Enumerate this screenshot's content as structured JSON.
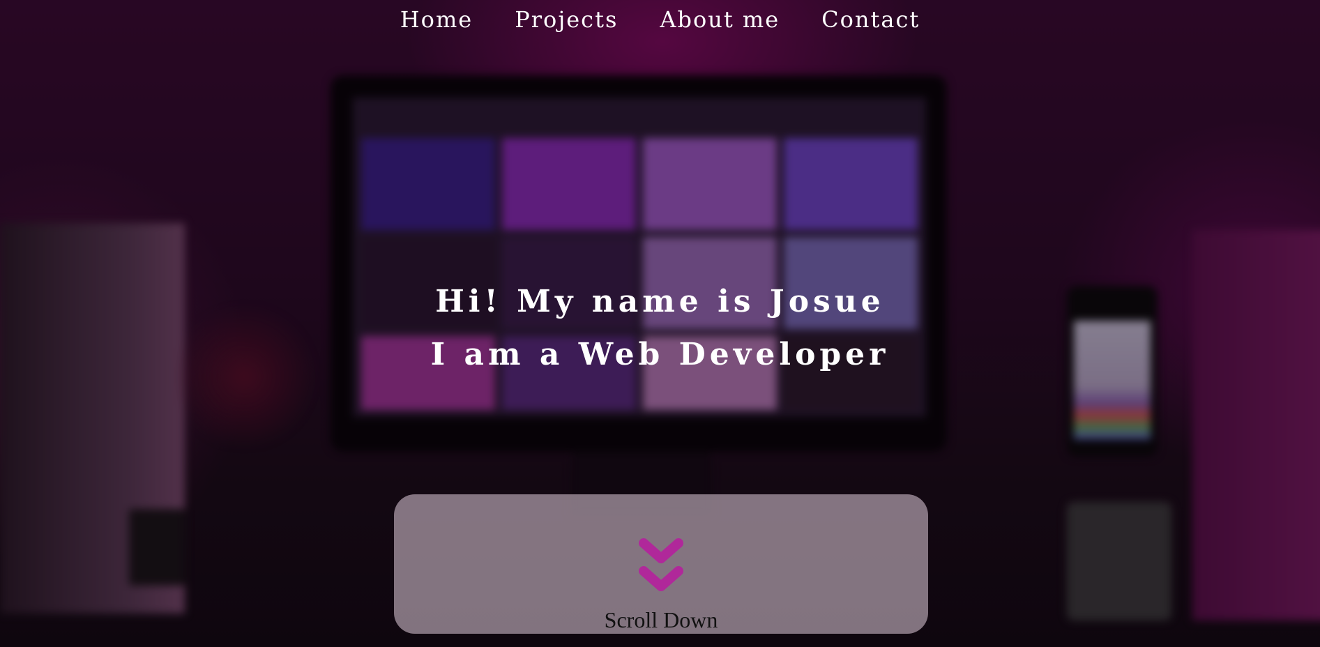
{
  "nav": {
    "items": [
      {
        "label": "Home"
      },
      {
        "label": "Projects"
      },
      {
        "label": "About me"
      },
      {
        "label": "Contact"
      }
    ]
  },
  "hero": {
    "line1": "Hi! My name is Josue",
    "line2": "I am a Web Developer"
  },
  "scroll": {
    "label": "Scroll Down",
    "icon": "double-chevron-down-icon",
    "icon_color": "#b0289a"
  },
  "colors": {
    "accent": "#b0289a",
    "text": "#ffffff"
  }
}
